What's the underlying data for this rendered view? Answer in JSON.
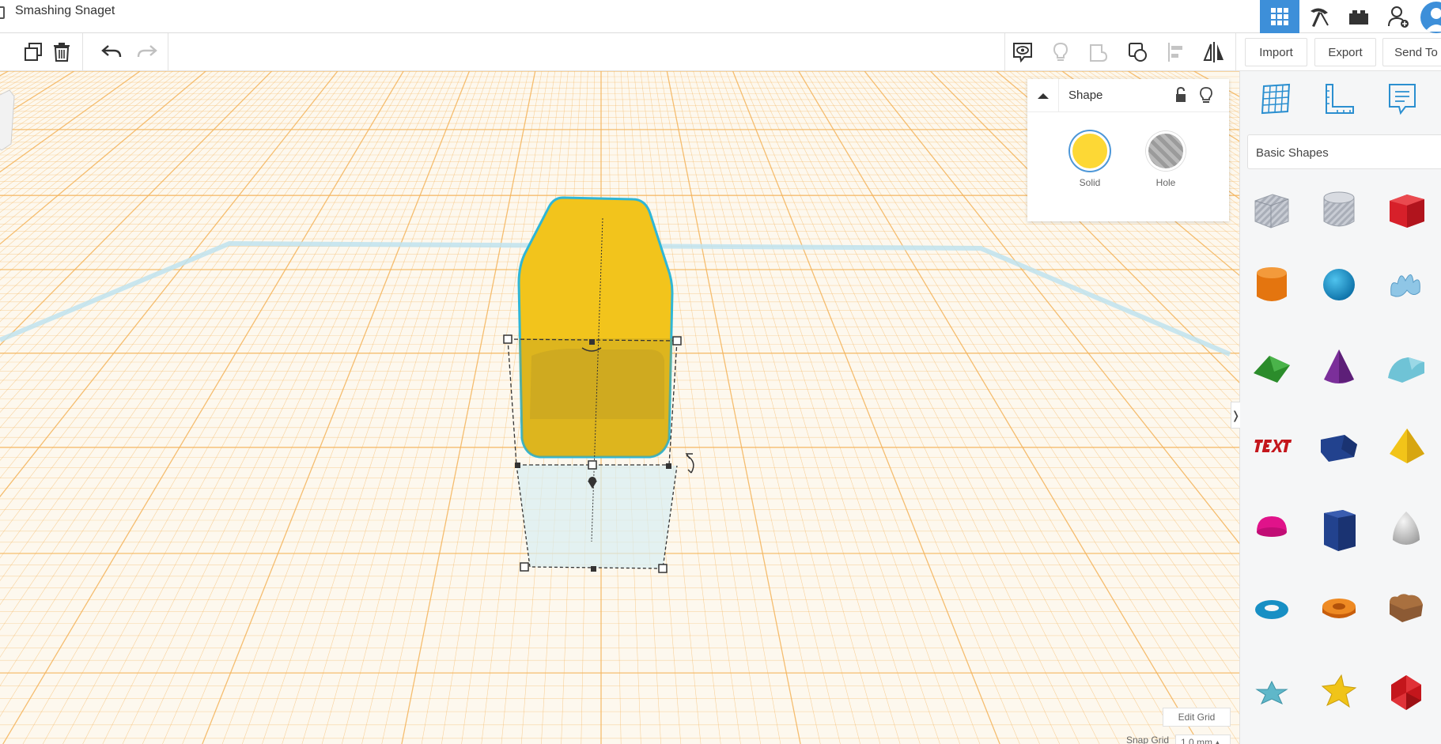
{
  "titlebar": {
    "document_title": "Smashing Snaget",
    "icons": [
      "grid-view-icon",
      "pickaxe-icon",
      "bricks-icon",
      "add-user-icon",
      "user-avatar"
    ]
  },
  "toolbar": {
    "left_icons": [
      "duplicate-icon",
      "delete-icon",
      "undo-icon",
      "redo-icon"
    ],
    "right_icons": [
      "comment-view-icon",
      "light-icon",
      "group-icon",
      "ungroup-icon",
      "align-icon",
      "mirror-icon"
    ],
    "import_label": "Import",
    "export_label": "Export",
    "send_to_label": "Send To"
  },
  "shape_panel": {
    "title": "Shape",
    "solid_label": "Solid",
    "hole_label": "Hole",
    "solid_color": "#fdd835"
  },
  "library": {
    "tabs": [
      "workplane-icon",
      "ruler-icon",
      "notes-icon"
    ],
    "category": "Basic Shapes",
    "shapes": [
      "box-hole",
      "cylinder-hole",
      "box",
      "cylinder",
      "sphere",
      "scribble",
      "roof",
      "cone",
      "round-roof",
      "text",
      "wedge",
      "pyramid",
      "half-sphere",
      "polygon",
      "paraboloid",
      "torus",
      "tube",
      "heart",
      "star",
      "star-yellow",
      "icosahedron"
    ]
  },
  "workplane": {
    "edit_grid_label": "Edit Grid",
    "snap_grid_label": "Snap Grid",
    "snap_grid_value": "1.0 mm ▴"
  },
  "colors": {
    "accent": "#3d8fd9",
    "grid_line": "#f4b35a",
    "selection": "#2fb6d6"
  }
}
